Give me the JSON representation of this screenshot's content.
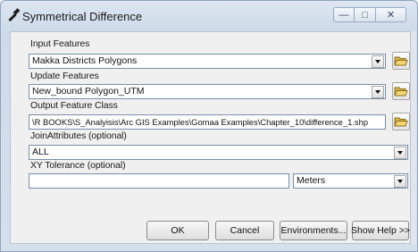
{
  "window": {
    "title": "Symmetrical Difference"
  },
  "titlebar": {
    "minimize": "—",
    "maximize": "□",
    "close": "✕"
  },
  "input_features": {
    "label": "Input Features",
    "value": "Makka Districts Polygons"
  },
  "update_features": {
    "label": "Update Features",
    "value": "New_bound Polygon_UTM"
  },
  "output_feature_class": {
    "label": "Output Feature Class",
    "value": "\\R BOOKS\\S_Analyisis\\Arc GIS Examples\\Gomaa Examples\\Chapter_10\\difference_1.shp"
  },
  "join_attributes": {
    "label": "JoinAttributes (optional)",
    "value": "ALL"
  },
  "xy_tolerance": {
    "label": "XY Tolerance (optional)",
    "value": "",
    "unit": "Meters"
  },
  "buttons": {
    "ok": "OK",
    "cancel": "Cancel",
    "environments": "Environments...",
    "show_help": "Show Help >>"
  },
  "icons": {
    "app": "hammer-tool-icon",
    "browse": "open-folder-icon",
    "dropdown": "chevron-down-icon"
  }
}
